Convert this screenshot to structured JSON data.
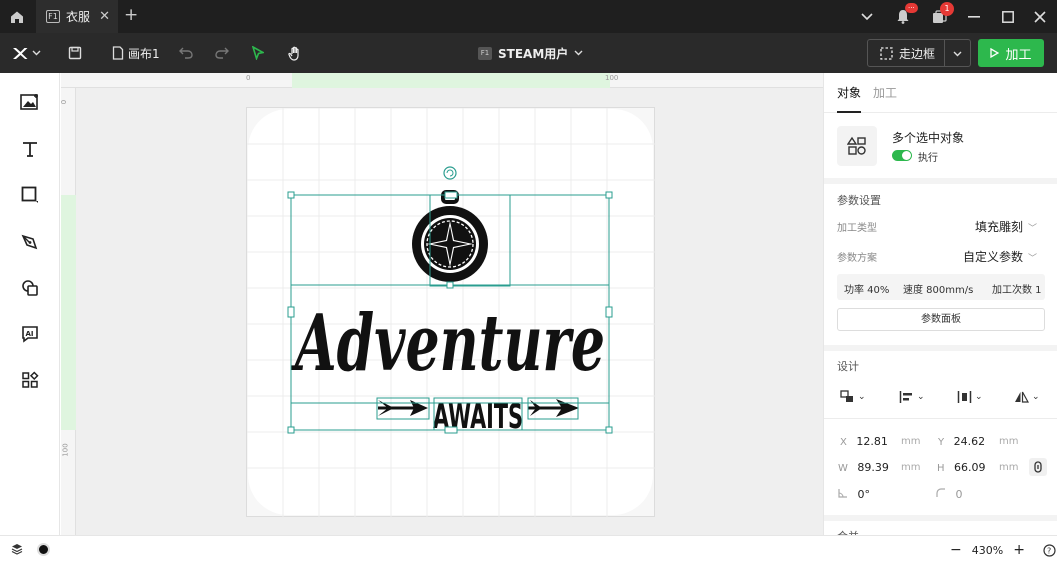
{
  "window": {
    "tab_title": "衣服",
    "tab_badge": "F1",
    "notification_badge": "···",
    "messages_badge": "1"
  },
  "toolbar": {
    "canvas_name": "画布1",
    "user_badge": "F1",
    "user_label": "STEAM用户",
    "frame_label": "走边框",
    "process_label": "加工"
  },
  "ruler": {
    "top_ticks": [
      "0",
      "100"
    ],
    "left_ticks": [
      "0",
      "100"
    ]
  },
  "panel": {
    "tabs": [
      "对象",
      "加工"
    ],
    "selection_title": "多个选中对象",
    "toggle_label": "执行",
    "params_title": "参数设置",
    "process_type_label": "加工类型",
    "process_type_value": "填充雕刻",
    "scheme_label": "参数方案",
    "scheme_value": "自定义参数",
    "power": "功率 40%",
    "speed": "速度 800mm/s",
    "passes": "加工次数 1",
    "param_panel_button": "参数面板",
    "design_title": "设计",
    "x_label": "X",
    "x_value": "12.81",
    "x_unit": "mm",
    "y_label": "Y",
    "y_value": "24.62",
    "y_unit": "mm",
    "w_label": "W",
    "w_value": "89.39",
    "w_unit": "mm",
    "h_label": "H",
    "h_value": "66.09",
    "h_unit": "mm",
    "rotation_value": "0°",
    "corner_value": "0",
    "next_section": "合并"
  },
  "artwork": {
    "main_word": "Adventure",
    "sub_word": "AWAITS"
  },
  "status": {
    "zoom": "430%"
  },
  "colors": {
    "accent": "#2db84d",
    "selection": "#2a9d8f",
    "dark_bar": "#1f1f1f"
  }
}
